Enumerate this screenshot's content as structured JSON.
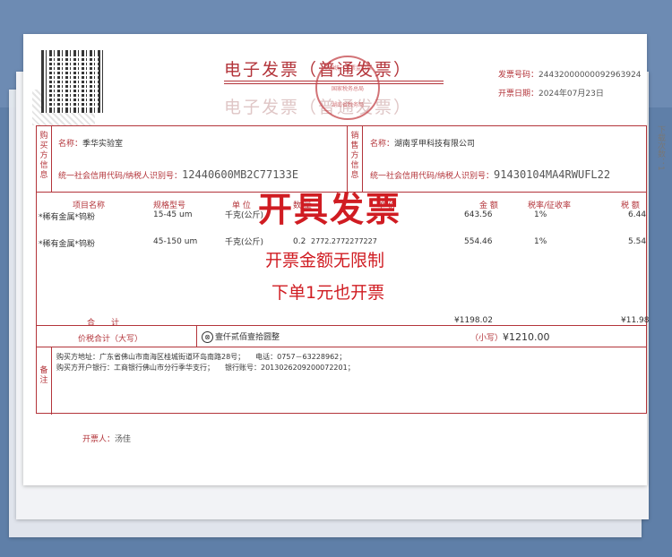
{
  "invoice": {
    "title": "电子发票（普通发票）",
    "seal_text_top": "全国统一发票监制章",
    "seal_text_mid": "国家税务总局",
    "seal_text_bottom": "湖南省税务局",
    "number_label": "发票号码：",
    "number_value": "24432000000092963924",
    "date_label": "开票日期：",
    "date_value": "2024年07月23日"
  },
  "buyer": {
    "side_label": "购买方信息",
    "name_label": "名称：",
    "name_value": "季华实验室",
    "id_label": "统一社会信用代码/纳税人识别号：",
    "id_value": "12440600MB2C77133E"
  },
  "seller": {
    "side_label": "销售方信息",
    "name_label": "名称：",
    "name_value": "湖南孚甲科技有限公司",
    "id_label": "统一社会信用代码/纳税人识别号：",
    "id_value": "91430104MA4RWUFL22"
  },
  "items": {
    "headers": [
      "项目名称",
      "规格型号",
      "单 位",
      "数 量",
      "单 价",
      "金 额",
      "税率/征收率",
      "税 额"
    ],
    "rows": [
      {
        "name": "*稀有金属*钨粉",
        "spec": "15-45 um",
        "unit": "千克(公斤)",
        "qty": "",
        "price": "",
        "amount": "643.56",
        "rate": "1%",
        "tax": "6.44"
      },
      {
        "name": "*稀有金属*钨粉",
        "spec": "45-150 um",
        "unit": "千克(公斤)",
        "qty": "0.2",
        "price": "2772.2772277227",
        "amount": "554.46",
        "rate": "1%",
        "tax": "5.54"
      }
    ],
    "total_label": "合　　计",
    "total_amount": "¥1198.02",
    "total_tax": "¥11.98"
  },
  "sum": {
    "label": "价税合计（大写）",
    "circle_char": "⊗",
    "upper_value": "壹仟贰佰壹拾圆整",
    "lower_label": "（小写）",
    "lower_value": "¥1210.00"
  },
  "remark": {
    "side_label": "备注",
    "line1": "购买方地址：广东省佛山市南海区桂城街道环岛南路28号；　　电话：0757－63228962；",
    "line2": "购买方开户银行：工商银行佛山市分行季华支行；　　银行账号：2013026209200072201；"
  },
  "footer": {
    "issuer_label": "开票人：",
    "issuer_name": "汤佳"
  },
  "overlay": {
    "headline": "开具发票",
    "line1": "开票金额无限制",
    "line2": "下单1元也开票"
  },
  "side_note": "下载次数：1",
  "colors": {
    "accent": "#b3343a",
    "promo": "#d01c22",
    "background": "#5f7fa8"
  }
}
